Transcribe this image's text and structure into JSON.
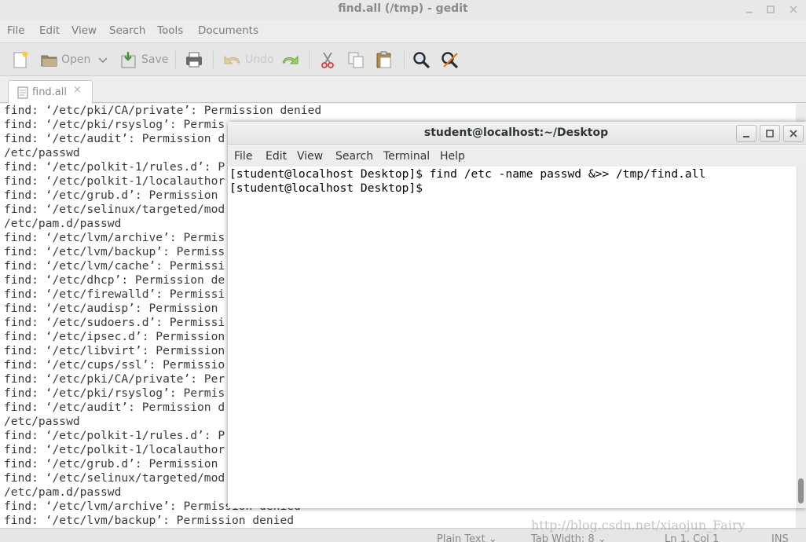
{
  "gedit": {
    "title": "find.all (/tmp) - gedit",
    "menu": [
      "File",
      "Edit",
      "View",
      "Search",
      "Tools",
      "Documents"
    ],
    "toolbar": {
      "open": "Open",
      "save": "Save",
      "undo": "Undo"
    },
    "tab": {
      "label": "find.all",
      "close": "×"
    },
    "lines": [
      "find: ‘/etc/pki/CA/private’: Permission denied",
      "find: ‘/etc/pki/rsyslog’: Permis",
      "find: ‘/etc/audit’: Permission d",
      "/etc/passwd",
      "find: ‘/etc/polkit-1/rules.d’: P",
      "find: ‘/etc/polkit-1/localauthor",
      "find: ‘/etc/grub.d’: Permission",
      "find: ‘/etc/selinux/targeted/mod",
      "/etc/pam.d/passwd",
      "find: ‘/etc/lvm/archive’: Permis",
      "find: ‘/etc/lvm/backup’: Permiss",
      "find: ‘/etc/lvm/cache’: Permissi",
      "find: ‘/etc/dhcp’: Permission de",
      "find: ‘/etc/firewalld’: Permissi",
      "find: ‘/etc/audisp’: Permission",
      "find: ‘/etc/sudoers.d’: Permissi",
      "find: ‘/etc/ipsec.d’: Permission",
      "find: ‘/etc/libvirt’: Permission",
      "find: ‘/etc/cups/ssl’: Permissio",
      "find: ‘/etc/pki/CA/private’: Per",
      "find: ‘/etc/pki/rsyslog’: Permis",
      "find: ‘/etc/audit’: Permission d",
      "/etc/passwd",
      "find: ‘/etc/polkit-1/rules.d’: P",
      "find: ‘/etc/polkit-1/localauthor",
      "find: ‘/etc/grub.d’: Permission",
      "find: ‘/etc/selinux/targeted/mod",
      "/etc/pam.d/passwd",
      "find: ‘/etc/lvm/archive’: Permission denied",
      "find: ‘/etc/lvm/backup’: Permission denied"
    ],
    "status": {
      "language": "Plain Text ⌄",
      "tab_width": "Tab Width: 8 ⌄",
      "position": "Ln 1, Col 1",
      "mode": "INS"
    }
  },
  "terminal": {
    "title": "student@localhost:~/Desktop",
    "menu": [
      "File",
      "Edit",
      "View",
      "Search",
      "Terminal",
      "Help"
    ],
    "lines": [
      "[student@localhost Desktop]$ find /etc -name passwd &>> /tmp/find.all",
      "[student@localhost Desktop]$ "
    ]
  },
  "watermark": "http://blog.csdn.net/xiaojun_Fairy"
}
